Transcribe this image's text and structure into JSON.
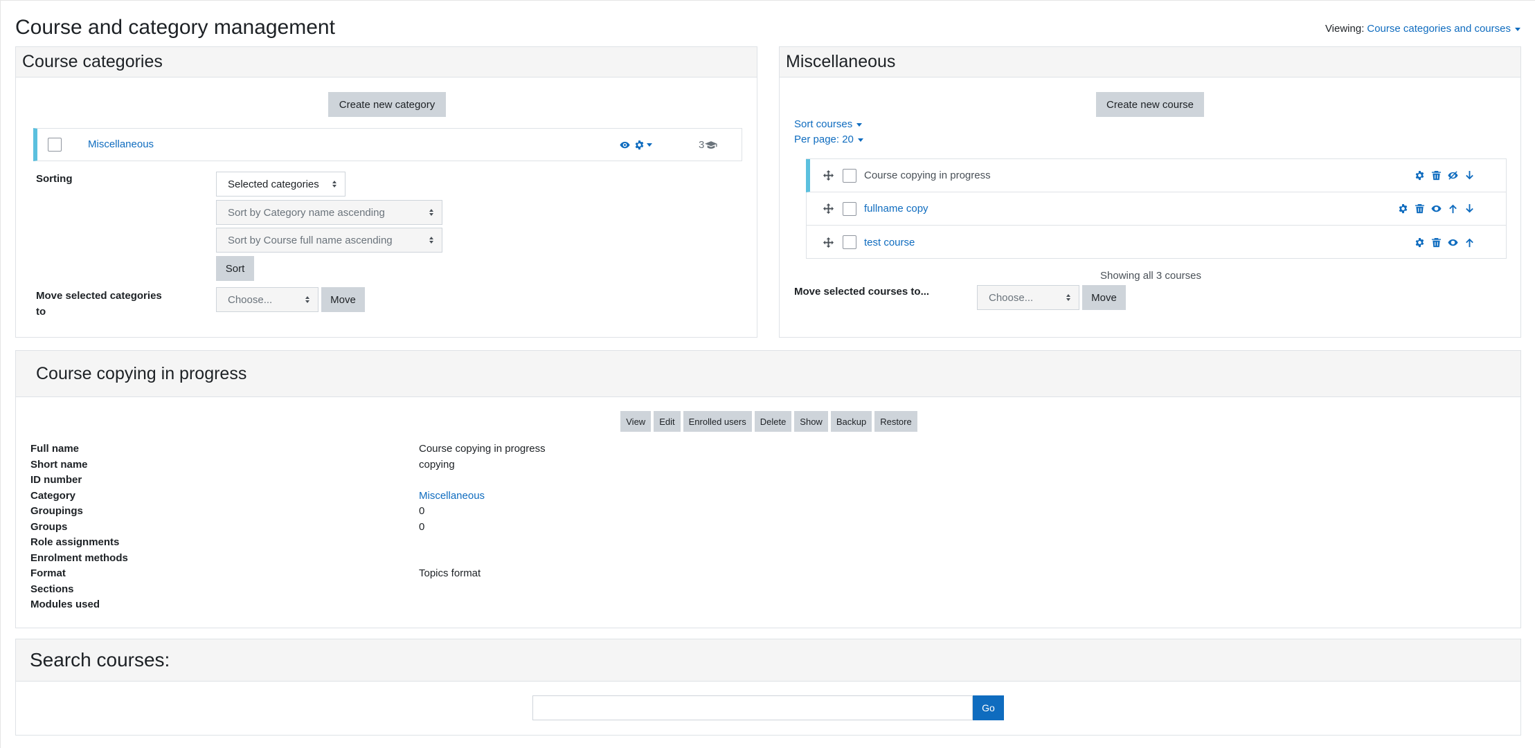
{
  "page": {
    "title": "Course and category management",
    "viewing_label": "Viewing:",
    "viewing_value": "Course categories and courses"
  },
  "categories_panel": {
    "title": "Course categories",
    "create_button": "Create new category",
    "category": {
      "name": "Miscellaneous",
      "course_count": "3"
    },
    "sorting_label": "Sorting",
    "sort_scope": "Selected categories",
    "sort_category_option": "Sort by Category name ascending",
    "sort_course_option": "Sort by Course full name ascending",
    "sort_button": "Sort",
    "move_label": "Move selected categories to",
    "move_choose": "Choose...",
    "move_button": "Move"
  },
  "courses_panel": {
    "title": "Miscellaneous",
    "create_button": "Create new course",
    "sort_courses": "Sort courses",
    "per_page": "Per page: 20",
    "courses": [
      {
        "name": "Course copying in progress"
      },
      {
        "name": "fullname copy"
      },
      {
        "name": "test course"
      }
    ],
    "showing": "Showing all 3 courses",
    "move_label": "Move selected courses to...",
    "move_choose": "Choose...",
    "move_button": "Move"
  },
  "detail_panel": {
    "title": "Course copying in progress",
    "actions": [
      "View",
      "Edit",
      "Enrolled users",
      "Delete",
      "Show",
      "Backup",
      "Restore"
    ],
    "rows": [
      {
        "key": "Full name",
        "value": "Course copying in progress"
      },
      {
        "key": "Short name",
        "value": "copying"
      },
      {
        "key": "ID number",
        "value": ""
      },
      {
        "key": "Category",
        "value": "Miscellaneous"
      },
      {
        "key": "Groupings",
        "value": "0"
      },
      {
        "key": "Groups",
        "value": "0"
      },
      {
        "key": "Role assignments",
        "value": ""
      },
      {
        "key": "Enrolment methods",
        "value": ""
      },
      {
        "key": "Format",
        "value": "Topics format"
      },
      {
        "key": "Sections",
        "value": ""
      },
      {
        "key": "Modules used",
        "value": ""
      }
    ]
  },
  "search_panel": {
    "title": "Search courses:",
    "input_value": "",
    "go_button": "Go"
  },
  "colors": {
    "link": "#0f6cbf",
    "accent_bar": "#5bc0de",
    "button_grey": "#ced4da",
    "primary": "#0f6cbf"
  }
}
